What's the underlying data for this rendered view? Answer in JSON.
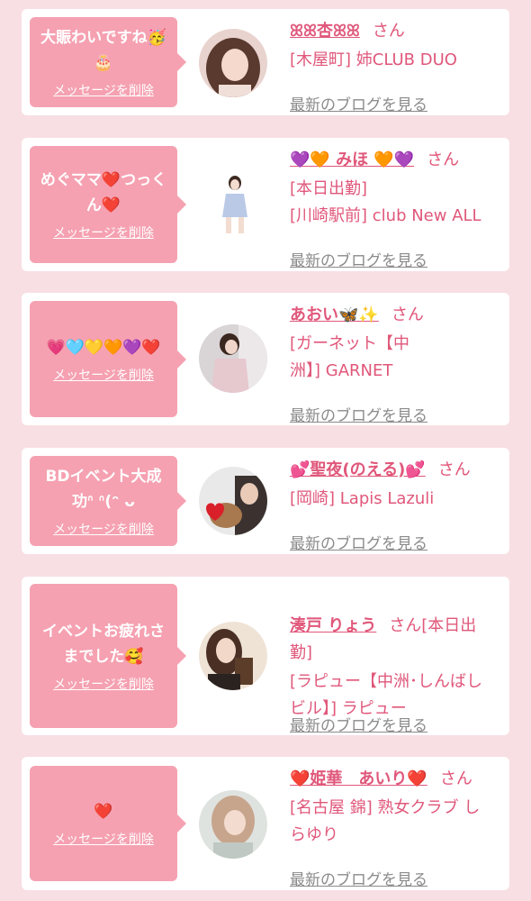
{
  "items": [
    {
      "message": "大賑わいですね🥳\n🎂",
      "delete_label": "メッセージを削除",
      "name": "ꕤ︎ꕤ︎杏ꕤ︎ꕤ︎",
      "san": "さん",
      "shop": "[木屋町] 姉CLUB DUO",
      "blog_label": "最新のブログを見る"
    },
    {
      "message": "めぐママ❤️つっく\nん❤️",
      "delete_label": "メッセージを削除",
      "name": "💜🧡 みほ 🧡💜",
      "san": "さん",
      "shop": "[本日出勤]\n[川崎駅前] club New ALL",
      "blog_label": "最新のブログを見る"
    },
    {
      "message": "💗🩵💛🧡💜❤️",
      "delete_label": "メッセージを削除",
      "name": "あおい🦋✨",
      "san": "さん",
      "shop": "[ガーネット【中\n洲】] GARNET",
      "blog_label": "最新のブログを見る"
    },
    {
      "message": "BDイベント大成\n功ᐢ ᐢ(ᵔ ᴗ",
      "delete_label": "メッセージを削除",
      "name": "💕聖夜(のえる)💕",
      "san": "さん",
      "shop": "[岡崎] Lapis Lazuli",
      "blog_label": "最新のブログを見る"
    },
    {
      "message": "イベントお疲れさ\nまでした🥰",
      "delete_label": "メッセージを削除",
      "name": "湊戸 りょう",
      "san": "さん[本日出\n勤]",
      "shop": "[ラピュー【中洲･しんばし\nビル】] ラピュー",
      "blog_label": "最新のブログを見る"
    },
    {
      "message": "❤️",
      "delete_label": "メッセージを削除",
      "name": "❤️姫華　あいり❤️",
      "san": "さん",
      "shop": "[名古屋 錦] 熟女クラブ し\nらゆり",
      "blog_label": "最新のブログを見る"
    }
  ]
}
